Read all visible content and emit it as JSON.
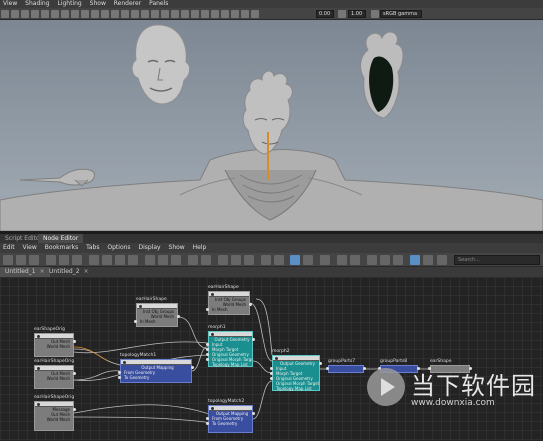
{
  "viewport": {
    "menu": [
      "View",
      "Shading",
      "Lighting",
      "Show",
      "Renderer",
      "Panels"
    ],
    "field_a": "0.00",
    "field_b": "1.00",
    "color_space": "sRGB gamma"
  },
  "panel_tabs": [
    "Script Editor",
    "Node Editor"
  ],
  "editor": {
    "menu": [
      "Edit",
      "View",
      "Bookmarks",
      "Tabs",
      "Options",
      "Display",
      "Show",
      "Help"
    ],
    "search_placeholder": "Search..."
  },
  "doc_tabs": [
    "Untitled_1",
    "Untitled_2"
  ],
  "nodes": {
    "ear_shape_orig": {
      "title": "earShapeOrig",
      "rows": [
        "Out Mesh",
        "World Mesh"
      ]
    },
    "hair_shape_orig": {
      "title": "earHairShapeOrig",
      "rows": [
        "Out Mesh",
        "World Mesh"
      ]
    },
    "hair_shape_orig2": {
      "title": "earHairShapeOrig",
      "rows": [
        "Message",
        "Out Mesh",
        "World Mesh"
      ]
    },
    "ear_hair_shape": {
      "title": "earHairShape",
      "rows": [
        "Inst Obj Groups",
        "World Mesh",
        "In Mesh"
      ]
    },
    "ear_hair_shape2": {
      "title": "earHairShape",
      "rows": [
        "Inst Obj Groups",
        "World Mesh",
        "In Mesh"
      ]
    },
    "topology_mesh1": {
      "title": "topologyMatch1",
      "rows": [
        "Output Mapping",
        "From Geometry",
        "To Geometry"
      ]
    },
    "topology_mesh2": {
      "title": "topologyMatch2",
      "rows": [
        "Output Mapping",
        "From Geometry",
        "To Geometry"
      ]
    },
    "morph1": {
      "title": "morph1",
      "rows": [
        "Output Geometry",
        "Input",
        "Morph Target",
        "Original Geometry",
        "Original Morph Target",
        "Topology Map List"
      ]
    },
    "morph2": {
      "title": "morph2",
      "rows": [
        "Output Geometry",
        "Input",
        "Morph Target",
        "Original Geometry",
        "Original Morph Target",
        "Topology Map List"
      ]
    },
    "group_parts7": {
      "title": "groupParts7"
    },
    "group_parts8": {
      "title": "groupParts8"
    },
    "ear_shape": {
      "title": "earShape"
    }
  },
  "watermark": {
    "brand": "当下软件园",
    "url": "www.downxia.com"
  },
  "colors": {
    "node_gray": "#7c7c7c",
    "node_blue": "#3a4ea0",
    "node_teal": "#1a8f8f",
    "wire": "#bdbdbd",
    "wire_orange": "#d98a2b"
  }
}
